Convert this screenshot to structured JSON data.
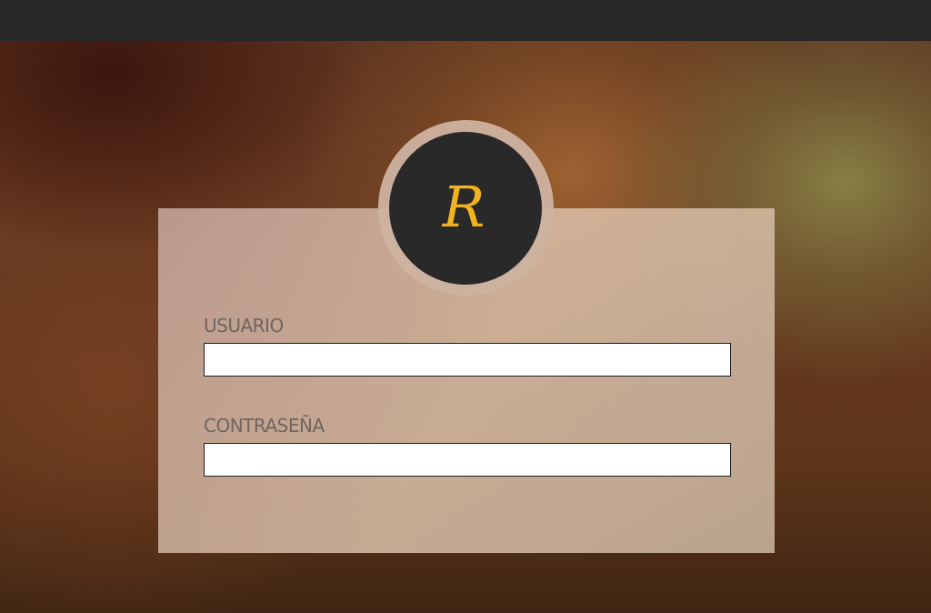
{
  "topbar": {},
  "login": {
    "avatar_letter": "R",
    "username": {
      "label": "USUARIO",
      "value": "",
      "placeholder": ""
    },
    "password": {
      "label": "CONTRASEÑA",
      "value": "",
      "placeholder": ""
    }
  },
  "colors": {
    "topbar": "#282828",
    "avatar_bg": "#292929",
    "avatar_letter": "#f2b21e",
    "label_text": "#6f6560",
    "card_bg": "#d2b9a6"
  }
}
